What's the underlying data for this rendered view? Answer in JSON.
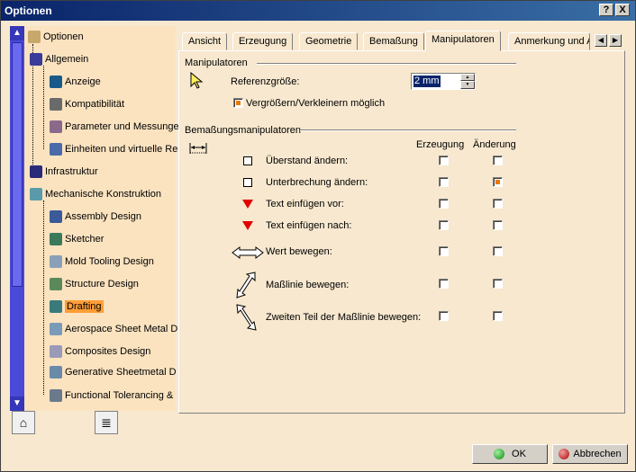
{
  "window": {
    "title": "Optionen",
    "help_label": "?",
    "close_label": "X"
  },
  "tree": {
    "root": "Optionen",
    "items": [
      {
        "label": "Allgemein",
        "level": 1
      },
      {
        "label": "Anzeige",
        "level": 2
      },
      {
        "label": "Kompatibilität",
        "level": 2
      },
      {
        "label": "Parameter und Messunge",
        "level": 2
      },
      {
        "label": "Einheiten und virtuelle Re",
        "level": 2
      },
      {
        "label": "Infrastruktur",
        "level": 1
      },
      {
        "label": "Mechanische Konstruktion",
        "level": 1
      },
      {
        "label": "Assembly Design",
        "level": 2
      },
      {
        "label": "Sketcher",
        "level": 2
      },
      {
        "label": "Mold Tooling Design",
        "level": 2
      },
      {
        "label": "Structure Design",
        "level": 2
      },
      {
        "label": "Drafting",
        "level": 2,
        "selected": true
      },
      {
        "label": "Aerospace Sheet Metal  D",
        "level": 2
      },
      {
        "label": "Composites Design",
        "level": 2
      },
      {
        "label": "Generative Sheetmetal D",
        "level": 2
      },
      {
        "label": "Functional Tolerancing &",
        "level": 2
      }
    ]
  },
  "tabs": [
    "Ansicht",
    "Erzeugung",
    "Geometrie",
    "Bemaßung",
    "Manipulatoren",
    "Anmerkung und A"
  ],
  "active_tab": "Manipulatoren",
  "manipulatoren": {
    "group_title": "Manipulatoren",
    "referenz_label": "Referenzgröße:",
    "referenz_value": "2 mm",
    "resize_label": "Vergrößern/Verkleinern möglich",
    "resize_checked": true
  },
  "bemassungsmanipulatoren": {
    "group_title": "Bemaßungsmanipulatoren",
    "col_erzeugung": "Erzeugung",
    "col_aenderung": "Änderung",
    "rows": [
      {
        "label": "Überstand ändern:",
        "erzeugung": false,
        "aenderung": false
      },
      {
        "label": "Unterbrechung ändern:",
        "erzeugung": false,
        "aenderung": true
      },
      {
        "label": "Text einfügen vor:",
        "erzeugung": false,
        "aenderung": false
      },
      {
        "label": "Text einfügen nach:",
        "erzeugung": false,
        "aenderung": false
      },
      {
        "label": "Wert bewegen:",
        "erzeugung": false,
        "aenderung": false
      },
      {
        "label": "Maßlinie bewegen:",
        "erzeugung": false,
        "aenderung": false
      },
      {
        "label": "Zweiten Teil der Maßlinie bewegen:",
        "erzeugung": false,
        "aenderung": false
      }
    ]
  },
  "buttons": {
    "ok": "OK",
    "cancel": "Abbrechen"
  }
}
